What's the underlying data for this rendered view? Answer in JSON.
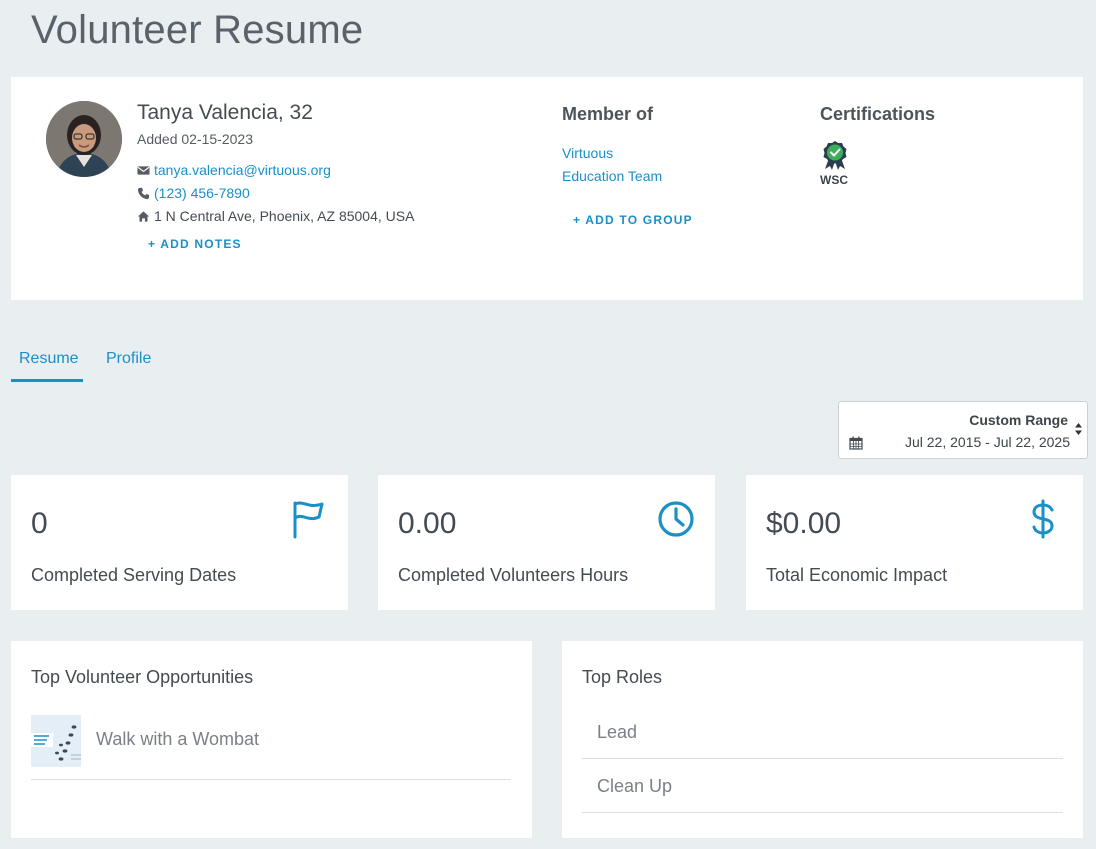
{
  "page": {
    "title": "Volunteer Resume"
  },
  "profile": {
    "name": "Tanya Valencia, 32",
    "added": "Added 02-15-2023",
    "email": "tanya.valencia@virtuous.org",
    "phone": "(123) 456-7890",
    "address": "1 N Central Ave, Phoenix, AZ 85004, USA",
    "add_notes_label": "+ ADD NOTES"
  },
  "member_of": {
    "heading": "Member of",
    "groups": [
      "Virtuous",
      "Education Team"
    ],
    "add_group_label": "+ ADD TO GROUP"
  },
  "certifications": {
    "heading": "Certifications",
    "items": [
      {
        "label": "WSC",
        "icon": "badge-check-icon",
        "color": "#3fae5a"
      }
    ]
  },
  "tabs": [
    {
      "label": "Resume",
      "active": true
    },
    {
      "label": "Profile",
      "active": false
    }
  ],
  "date_range": {
    "mode": "Custom Range",
    "value": "Jul 22, 2015 - Jul 22, 2025"
  },
  "stats": [
    {
      "value": "0",
      "label": "Completed Serving Dates",
      "icon": "flag-icon"
    },
    {
      "value": "0.00",
      "label": "Completed Volunteers Hours",
      "icon": "clock-icon"
    },
    {
      "value": "$0.00",
      "label": "Total Economic Impact",
      "icon": "dollar-icon"
    }
  ],
  "top_opportunities": {
    "title": "Top Volunteer Opportunities",
    "items": [
      {
        "name": "Walk with a Wombat"
      }
    ]
  },
  "top_roles": {
    "title": "Top Roles",
    "items": [
      {
        "name": "Lead"
      },
      {
        "name": "Clean Up"
      }
    ]
  },
  "colors": {
    "accent": "#1a8fc8",
    "background": "#e9eef1",
    "card": "#ffffff"
  }
}
